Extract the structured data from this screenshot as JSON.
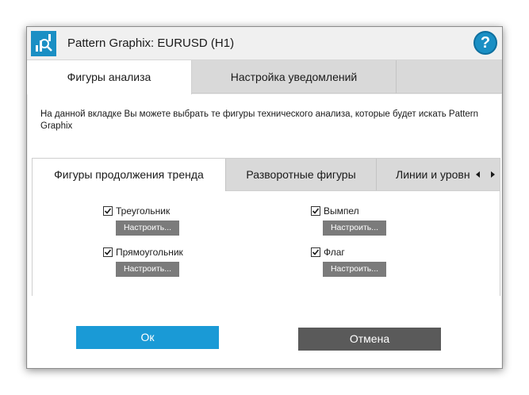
{
  "window": {
    "title": "Pattern Graphix: EURUSD (H1)",
    "help_label": "?",
    "accent_color": "#1a9ad6"
  },
  "top_tabs": [
    {
      "label": "Фигуры анализа",
      "active": true
    },
    {
      "label": "Настройка уведомлений",
      "active": false
    }
  ],
  "description": "На данной вкладке Вы можете выбрать те фигуры технического анализа, которые будет искать Pattern Graphix",
  "sub_tabs": [
    {
      "label": "Фигуры продолжения тренда",
      "active": true
    },
    {
      "label": "Разворотные фигуры",
      "active": false
    },
    {
      "label": "Линии и уровни",
      "active": false
    }
  ],
  "patterns": [
    {
      "label": "Треугольник",
      "checked": true,
      "button": "Настроить..."
    },
    {
      "label": "Вымпел",
      "checked": true,
      "button": "Настроить..."
    },
    {
      "label": "Прямоугольник",
      "checked": true,
      "button": "Настроить..."
    },
    {
      "label": "Флаг",
      "checked": true,
      "button": "Настроить..."
    }
  ],
  "footer": {
    "ok_label": "Ок",
    "cancel_label": "Отмена"
  },
  "icons": {
    "app": "pattern-graphix-icon",
    "help": "help-icon",
    "scroll_left": "arrow-left-icon",
    "scroll_right": "arrow-right-icon",
    "checkmark": "checkmark-icon"
  }
}
